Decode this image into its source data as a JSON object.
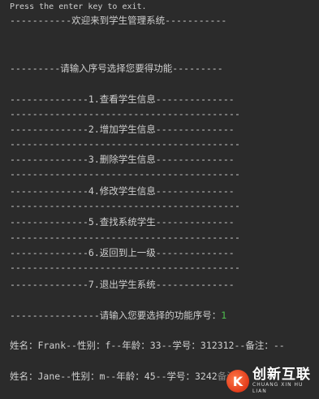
{
  "console": {
    "exit_prompt": "Press the enter key to exit.",
    "welcome": "-----------欢迎来到学生管理系统-----------",
    "select_prompt": "---------请输入序号选择您要得功能---------",
    "menu": [
      {
        "label": "--------------1.查看学生信息--------------",
        "divider": "-----------------------------------------"
      },
      {
        "label": "--------------2.增加学生信息--------------",
        "divider": "-----------------------------------------"
      },
      {
        "label": "--------------3.删除学生信息--------------",
        "divider": "-----------------------------------------"
      },
      {
        "label": "--------------4.修改学生信息--------------",
        "divider": "-----------------------------------------"
      },
      {
        "label": "--------------5.查找系统学生--------------",
        "divider": "-----------------------------------------"
      },
      {
        "label": "--------------6.返回到上一级--------------",
        "divider": "-----------------------------------------"
      },
      {
        "label": "--------------7.退出学生系统--------------",
        "divider": ""
      }
    ],
    "input_prompt": "----------------请输入您要选择的功能序号：",
    "input_value": "1",
    "records": [
      "姓名：Frank--性别：f--年龄：33--学号：312312--备注：--",
      "姓名：Jane--性别：m--年龄：45--学号：3242"
    ],
    "last_record_tail": "备注"
  },
  "watermark": {
    "logo_glyph": "K",
    "title": "创新互联",
    "subtitle": "CHUANG XIN HU LIAN"
  },
  "colors": {
    "background": "#2b2b2b",
    "text": "#cfcfcf",
    "input": "#4fbf4f",
    "watermark_accent": "#e23b1a"
  }
}
